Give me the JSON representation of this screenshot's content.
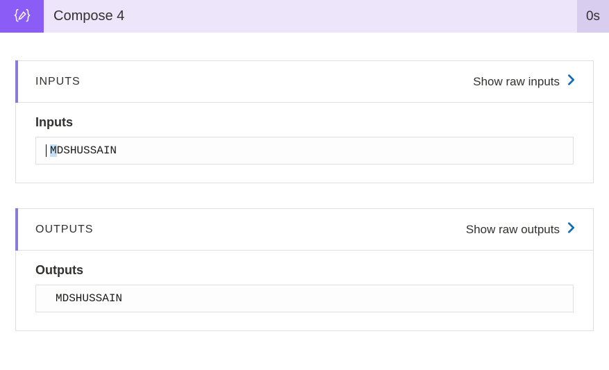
{
  "action": {
    "title": "Compose 4",
    "duration": "0s"
  },
  "inputs": {
    "header_label": "INPUTS",
    "show_raw_label": "Show raw inputs",
    "field_label": "Inputs",
    "value_first_char": "M",
    "value_rest": "DSHUSSAIN"
  },
  "outputs": {
    "header_label": "OUTPUTS",
    "show_raw_label": "Show raw outputs",
    "field_label": "Outputs",
    "value": "MDSHUSSAIN"
  }
}
